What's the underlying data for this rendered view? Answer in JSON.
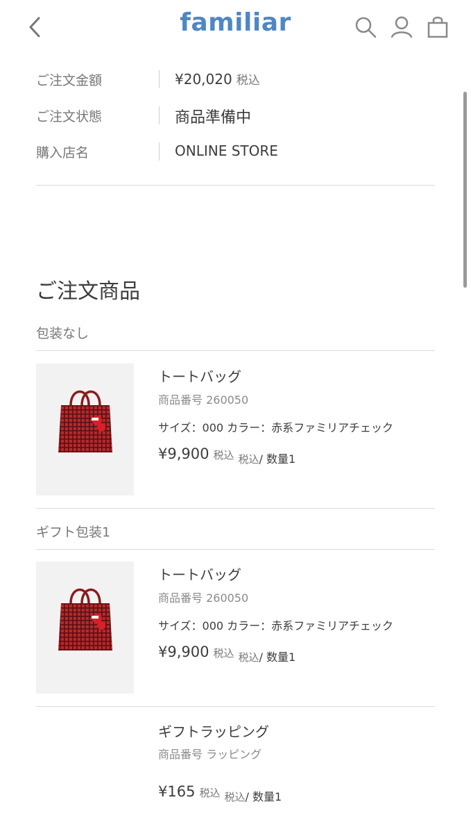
{
  "header": {
    "logo": "familiar",
    "icons": [
      "chevron-left-icon",
      "search-icon",
      "user-icon",
      "shopping-bag-icon"
    ],
    "logo_color": "#4f87c4"
  },
  "summary": {
    "rows": [
      {
        "label": "ご注文金額",
        "value": "¥20,020",
        "suffix": "税込"
      },
      {
        "label": "ご注文状態",
        "value": "商品準備中"
      },
      {
        "label": "購入店名",
        "value": "ONLINE STORE"
      }
    ]
  },
  "section": {
    "title": "ご注文商品",
    "groups": [
      {
        "label": "包装なし",
        "item": {
          "name": "トートバッグ",
          "code": "商品番号 260050",
          "attrs": "サイズ：000 カラー：赤系ファミリアチェック",
          "price": "¥9,900",
          "tax1": "税込",
          "tax2": "税込",
          "qty": "/ 数量1"
        }
      },
      {
        "label": "ギフト包装1",
        "item": {
          "name": "トートバッグ",
          "code": "商品番号 260050",
          "attrs": "サイズ：000 カラー：赤系ファミリアチェック",
          "price": "¥9,900",
          "tax1": "税込",
          "tax2": "税込",
          "qty": "/ 数量1"
        },
        "wrap": {
          "name": "ギフトラッピング",
          "code": "商品番号 ラッピング",
          "price": "¥165",
          "tax1": "税込",
          "tax2": "税込",
          "qty": "/ 数量1"
        }
      }
    ]
  },
  "colors": {
    "bag_red": "#b52a2a",
    "bag_check": "#5a0f14",
    "thumb_bg": "#f2f2f2"
  }
}
